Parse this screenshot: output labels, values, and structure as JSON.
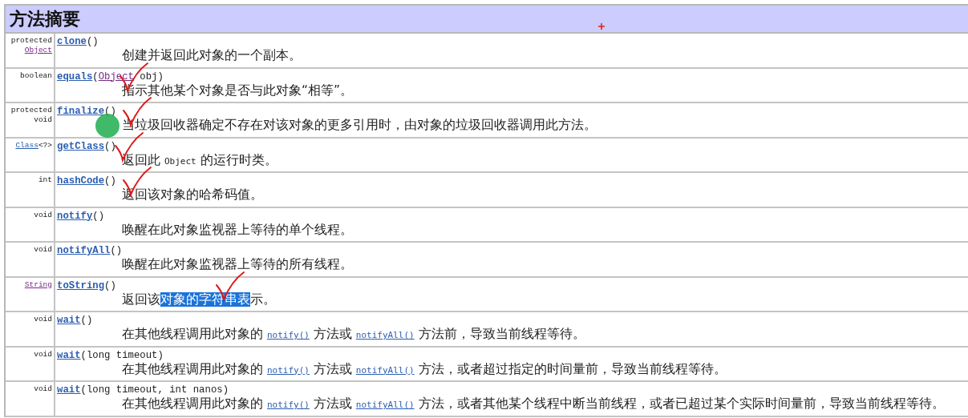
{
  "header": {
    "title": "方法摘要",
    "cursor_mark": true
  },
  "rows": [
    {
      "type": [
        {
          "parts": [
            {
              "kind": "text",
              "text": "protected"
            }
          ]
        },
        {
          "parts": [
            {
              "kind": "visited",
              "text": "Object"
            }
          ]
        }
      ],
      "name": "clone",
      "params": [
        {
          "kind": "text",
          "text": "()"
        }
      ],
      "desc": [
        {
          "kind": "text",
          "text": "创建并返回此对象的一个副本。"
        }
      ],
      "checked": false,
      "dot": false
    },
    {
      "type": [
        {
          "parts": [
            {
              "kind": "text",
              "text": "boolean"
            }
          ]
        }
      ],
      "name": "equals",
      "params": [
        {
          "kind": "text",
          "text": "("
        },
        {
          "kind": "visited",
          "text": "Object"
        },
        {
          "kind": "text",
          "text": " obj)"
        }
      ],
      "desc": [
        {
          "kind": "text",
          "text": "指示其他某个对象是否与此对象“相等”。"
        }
      ],
      "checked": true,
      "dot": false
    },
    {
      "type": [
        {
          "parts": [
            {
              "kind": "text",
              "text": "protected"
            }
          ]
        },
        {
          "parts": [
            {
              "kind": "text",
              "text": "void"
            }
          ]
        }
      ],
      "name": "finalize",
      "params": [
        {
          "kind": "text",
          "text": "()"
        }
      ],
      "desc": [
        {
          "kind": "text",
          "text": "当垃圾回收器确定不存在对该对象的更多引用时，由对象的垃圾回收器调用此方法。"
        }
      ],
      "checked": true,
      "dot": true
    },
    {
      "type": [
        {
          "parts": [
            {
              "kind": "link",
              "text": "Class"
            },
            {
              "kind": "text",
              "text": "<?>"
            }
          ]
        }
      ],
      "name": "getClass",
      "params": [
        {
          "kind": "text",
          "text": "()"
        }
      ],
      "desc": [
        {
          "kind": "text",
          "text": "返回此 "
        },
        {
          "kind": "code",
          "text": "Object"
        },
        {
          "kind": "text",
          "text": " 的运行时类。"
        }
      ],
      "checked": true,
      "dot": false
    },
    {
      "type": [
        {
          "parts": [
            {
              "kind": "text",
              "text": "int"
            }
          ]
        }
      ],
      "name": "hashCode",
      "params": [
        {
          "kind": "text",
          "text": "()"
        }
      ],
      "desc": [
        {
          "kind": "text",
          "text": "返回该对象的哈希码值。"
        }
      ],
      "checked": true,
      "dot": false
    },
    {
      "type": [
        {
          "parts": [
            {
              "kind": "text",
              "text": "void"
            }
          ]
        }
      ],
      "name": "notify",
      "params": [
        {
          "kind": "text",
          "text": "()"
        }
      ],
      "desc": [
        {
          "kind": "text",
          "text": "唤醒在此对象监视器上等待的单个线程。"
        }
      ],
      "checked": false,
      "dot": false
    },
    {
      "type": [
        {
          "parts": [
            {
              "kind": "text",
              "text": "void"
            }
          ]
        }
      ],
      "name": "notifyAll",
      "params": [
        {
          "kind": "text",
          "text": "()"
        }
      ],
      "desc": [
        {
          "kind": "text",
          "text": "唤醒在此对象监视器上等待的所有线程。"
        }
      ],
      "checked": false,
      "dot": false
    },
    {
      "type": [
        {
          "parts": [
            {
              "kind": "visited",
              "text": "String"
            }
          ]
        }
      ],
      "name": "toString",
      "params": [
        {
          "kind": "text",
          "text": "()"
        }
      ],
      "desc": [
        {
          "kind": "text",
          "text": "返回该"
        },
        {
          "kind": "selection",
          "text": "对象的字符串表"
        },
        {
          "kind": "text",
          "text": "示。"
        }
      ],
      "checked": true,
      "dot": false
    },
    {
      "type": [
        {
          "parts": [
            {
              "kind": "text",
              "text": "void"
            }
          ]
        }
      ],
      "name": "wait",
      "params": [
        {
          "kind": "text",
          "text": "()"
        }
      ],
      "desc": [
        {
          "kind": "text",
          "text": "在其他线程调用此对象的 "
        },
        {
          "kind": "link",
          "text": "notify()"
        },
        {
          "kind": "text",
          "text": " 方法或 "
        },
        {
          "kind": "link",
          "text": "notifyAll()"
        },
        {
          "kind": "text",
          "text": " 方法前，导致当前线程等待。"
        }
      ],
      "checked": false,
      "dot": false
    },
    {
      "type": [
        {
          "parts": [
            {
              "kind": "text",
              "text": "void"
            }
          ]
        }
      ],
      "name": "wait",
      "params": [
        {
          "kind": "text",
          "text": "(long timeout)"
        }
      ],
      "desc": [
        {
          "kind": "text",
          "text": "在其他线程调用此对象的 "
        },
        {
          "kind": "link",
          "text": "notify()"
        },
        {
          "kind": "text",
          "text": " 方法或 "
        },
        {
          "kind": "link",
          "text": "notifyAll()"
        },
        {
          "kind": "text",
          "text": " 方法，或者超过指定的时间量前，导致当前线程等待。"
        }
      ],
      "checked": false,
      "dot": false
    },
    {
      "type": [
        {
          "parts": [
            {
              "kind": "text",
              "text": "void"
            }
          ]
        }
      ],
      "name": "wait",
      "params": [
        {
          "kind": "text",
          "text": "(long timeout, int nanos)"
        }
      ],
      "desc": [
        {
          "kind": "text",
          "text": "在其他线程调用此对象的 "
        },
        {
          "kind": "link",
          "text": "notify()"
        },
        {
          "kind": "text",
          "text": " 方法或 "
        },
        {
          "kind": "link",
          "text": "notifyAll()"
        },
        {
          "kind": "text",
          "text": " 方法，或者其他某个线程中断当前线程，或者已超过某个实际时间量前，导致当前线程等待。"
        }
      ],
      "checked": false,
      "dot": false
    }
  ]
}
